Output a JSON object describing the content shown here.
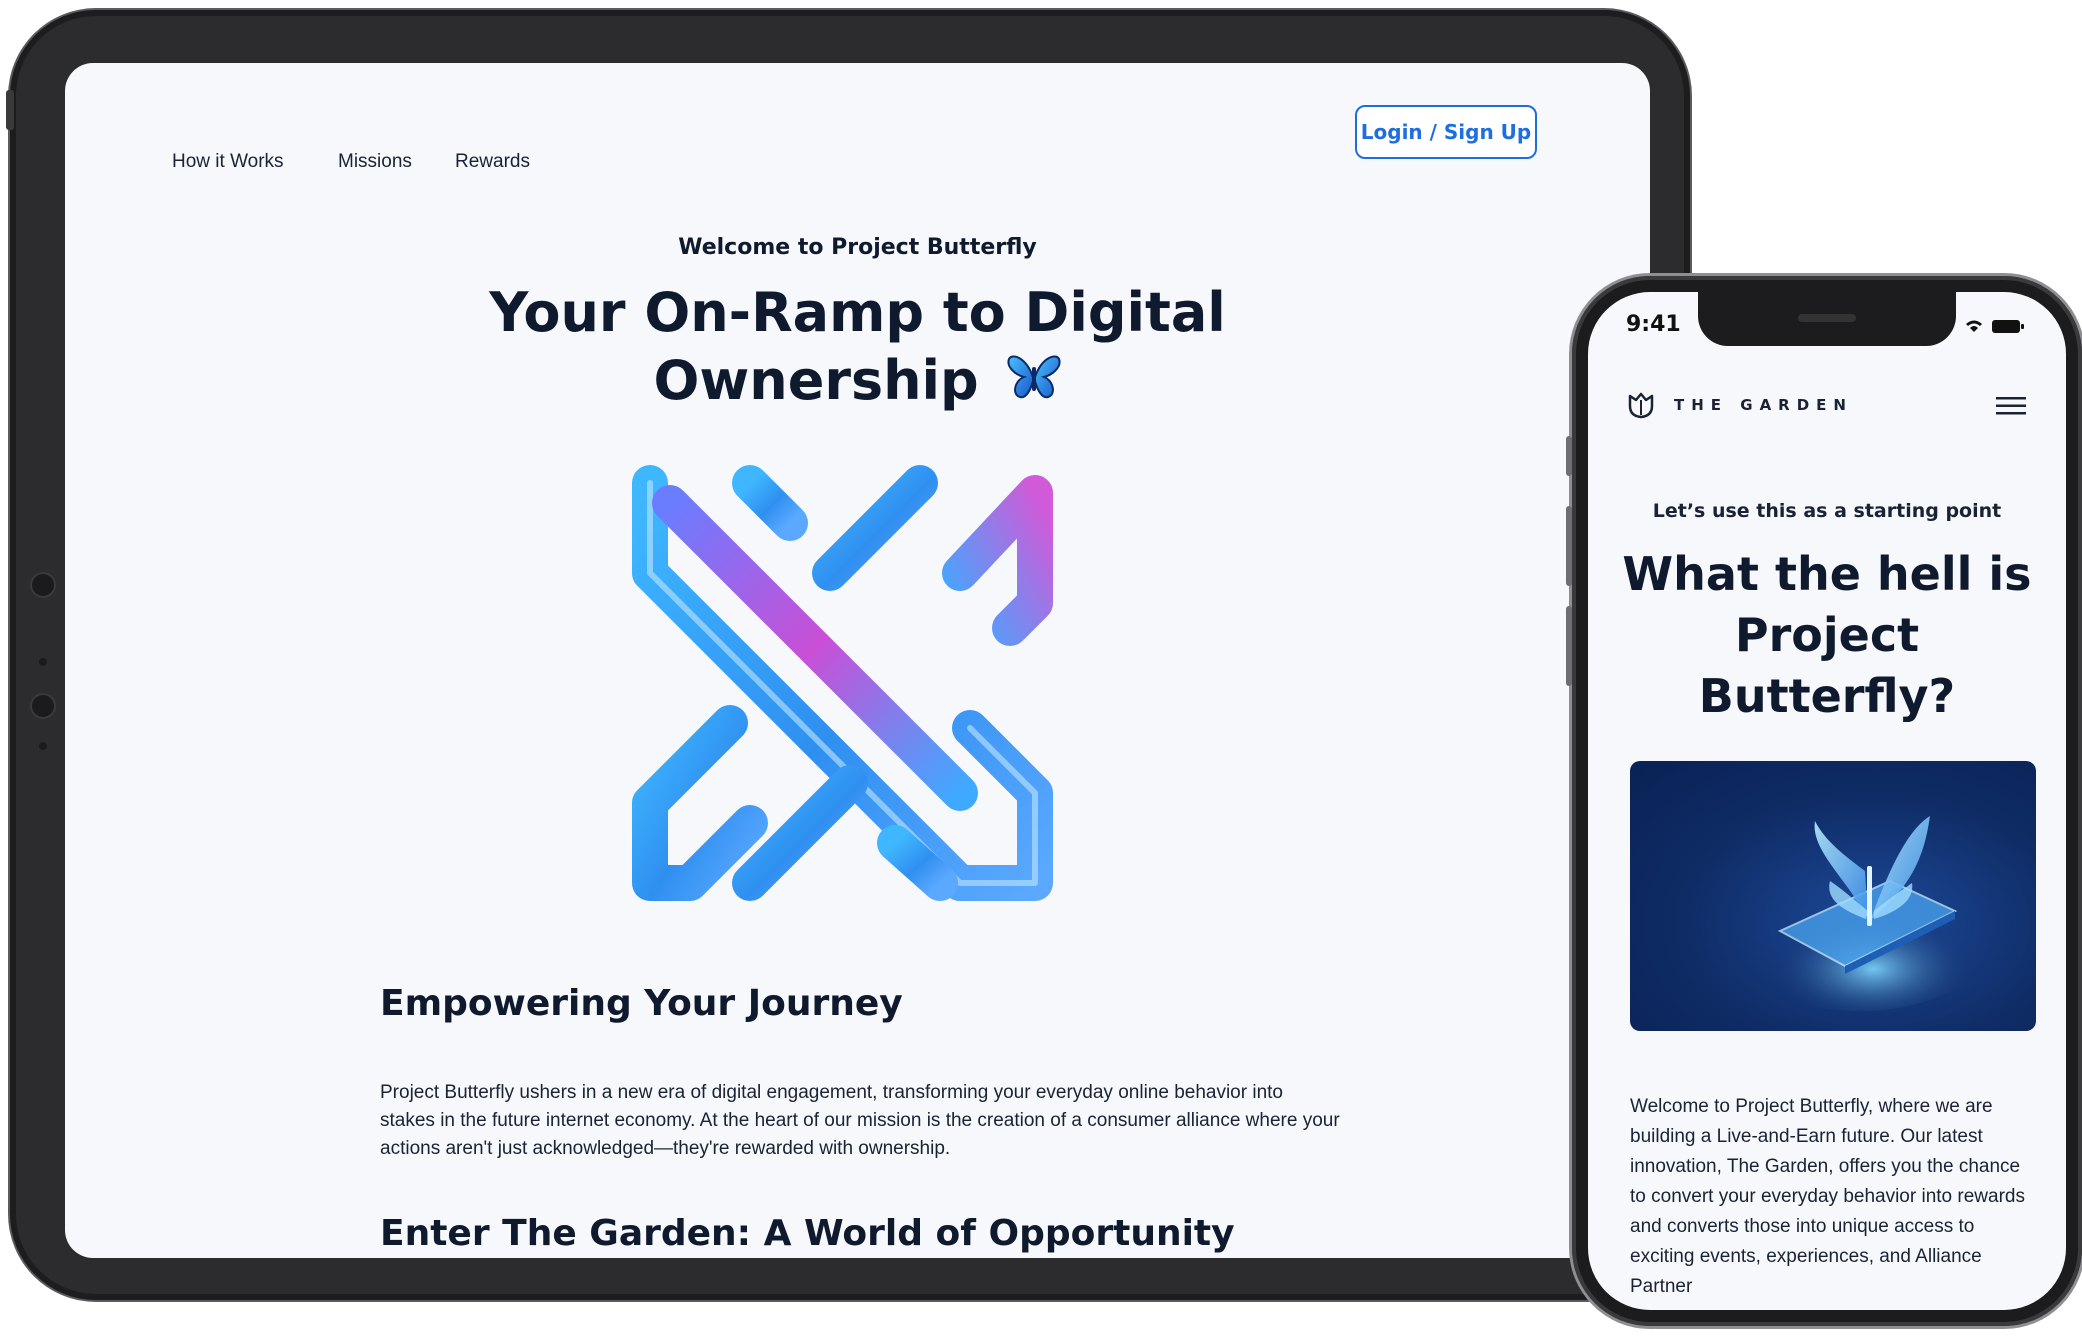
{
  "tablet": {
    "nav": {
      "links": [
        "How it Works",
        "Missions",
        "Rewards"
      ],
      "login_label": "Login / Sign Up"
    },
    "hero": {
      "eyebrow": "Welcome to Project Butterfly",
      "title_line1": "Your On-Ramp to Digital",
      "title_line2": "Ownership",
      "title_emoji_icon": "butterfly-icon"
    },
    "section1": {
      "heading": "Empowering Your Journey",
      "body": "Project Butterfly ushers in a new era of digital engagement, transforming your everyday online behavior into stakes in the future internet economy. At the heart of our mission is the creation of a consumer alliance where your actions aren't just acknowledged—they're rewarded with ownership."
    },
    "section2": {
      "heading": "Enter The Garden: A World of Opportunity"
    }
  },
  "phone": {
    "status": {
      "time": "9:41"
    },
    "header": {
      "brand": "THE GARDEN",
      "logo_icon": "tulip-logo-icon",
      "menu_icon": "hamburger-menu-icon"
    },
    "hero": {
      "eyebrow": "Let’s use this as a starting point",
      "title": "What the hell is Project Butterfly?"
    },
    "body": "Welcome to Project Butterfly, where we are building a Live-and-Earn future. Our latest innovation, The Garden, offers you the chance to convert your everyday behavior into rewards and converts those into unique access to exciting events, experiences, and Alliance Partner"
  },
  "colors": {
    "accent": "#1d6fe0",
    "text_dark": "#0f1a2e",
    "page_bg": "#f7f8fb",
    "device_frame": "#2c2c2e",
    "logo_gradient_start": "#3fb7ff",
    "logo_gradient_end": "#c94fd6"
  }
}
